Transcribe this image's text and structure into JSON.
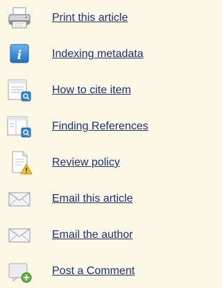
{
  "reading_tools": {
    "items": [
      {
        "label": "Print this article",
        "icon": "printer-icon"
      },
      {
        "label": "Indexing metadata",
        "icon": "info-icon"
      },
      {
        "label": "How to cite item",
        "icon": "cite-document-icon"
      },
      {
        "label": "Finding References",
        "icon": "find-references-icon"
      },
      {
        "label": "Review policy",
        "icon": "warning-document-icon"
      },
      {
        "label": "Email this article",
        "icon": "envelope-icon"
      },
      {
        "label": "Email the author",
        "icon": "envelope-icon"
      },
      {
        "label": "Post a Comment",
        "icon": "add-comment-icon"
      }
    ]
  },
  "colors": {
    "background": "#fdf8e6",
    "link": "#18307e",
    "info_blue": "#2f86d6",
    "warning_yellow": "#f4c21f",
    "add_green": "#5db33a"
  }
}
